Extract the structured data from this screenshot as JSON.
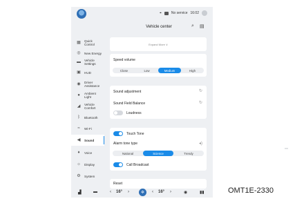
{
  "status": {
    "signal": "No service",
    "time": "16:02"
  },
  "header": {
    "title": "Vehicle center"
  },
  "sidebar": {
    "items": [
      {
        "label": "Quick Control",
        "icon": "grid-icon",
        "active": false
      },
      {
        "label": "New Energy",
        "icon": "leaf-icon",
        "active": false
      },
      {
        "label": "Vehicle Settings",
        "icon": "car-icon",
        "active": false
      },
      {
        "label": "HUD",
        "icon": "hud-icon",
        "active": false
      },
      {
        "label": "Driver Assistance",
        "icon": "steering-icon",
        "active": false
      },
      {
        "label": "Ambient Light",
        "icon": "bulb-icon",
        "active": false
      },
      {
        "label": "Vehicle Comfort",
        "icon": "seat-icon",
        "active": false
      },
      {
        "label": "Bluetooth",
        "icon": "bluetooth-icon",
        "active": false
      },
      {
        "label": "Wi-Fi",
        "icon": "wifi-icon",
        "active": false
      },
      {
        "label": "Sound",
        "icon": "speaker-icon",
        "active": true
      },
      {
        "label": "Voice",
        "icon": "mic-icon",
        "active": false
      },
      {
        "label": "Display",
        "icon": "sun-icon",
        "active": false
      },
      {
        "label": "System",
        "icon": "gear-icon",
        "active": false
      }
    ]
  },
  "sound": {
    "expand_hint": "Expand More ∨",
    "speed_volume": {
      "label": "Speed volume",
      "options": [
        "Close",
        "Low",
        "Medium",
        "High"
      ],
      "selected": "Medium"
    },
    "sound_adjustment": "Sound adjustment",
    "sound_field_balance": "Sound Field Balance",
    "loudness": {
      "label": "Loudness",
      "on": false
    },
    "touch_tone": {
      "label": "Touch Tone",
      "on": true
    },
    "alarm_tone": {
      "label": "Alarm tone type",
      "options": [
        "National",
        "Science",
        "Trendy"
      ],
      "selected": "Science"
    },
    "call_broadcast": {
      "label": "Call Broadcast",
      "on": true
    },
    "reset": "Reset"
  },
  "bottombar": {
    "temp_left": "16°",
    "temp_right": "16°"
  },
  "watermark": "OMT1E-2330",
  "colors": {
    "accent": "#1a8be8",
    "background": "#eef0f3",
    "card": "#ffffff"
  }
}
